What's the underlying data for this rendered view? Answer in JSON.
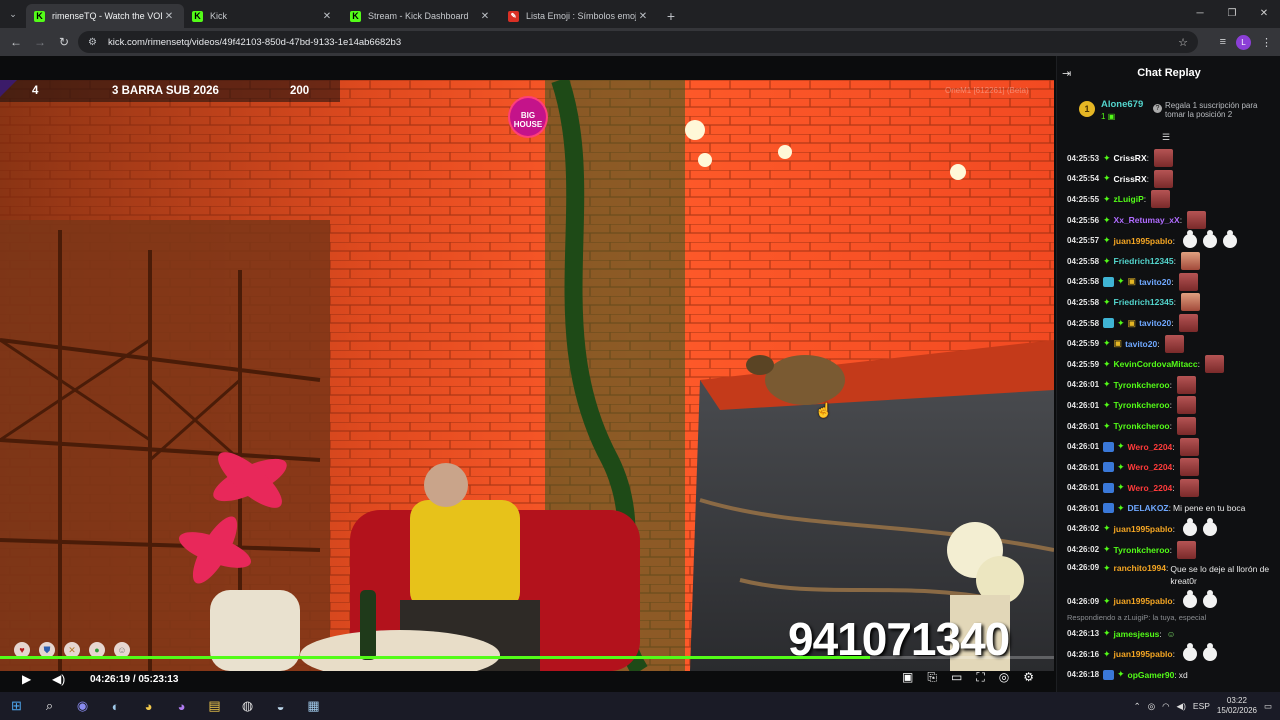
{
  "browser": {
    "tabs": [
      {
        "title": "rimenseTQ - Watch the VOD o",
        "favicon": "K",
        "active": true
      },
      {
        "title": "Kick",
        "favicon": "K",
        "active": false
      },
      {
        "title": "Stream - Kick Dashboard",
        "favicon": "K",
        "active": false
      },
      {
        "title": "Lista Emoji : Símbolos emoji na",
        "favicon": "emoji",
        "active": false
      }
    ],
    "url": "kick.com/rimensetq/videos/49f42103-850d-47bd-9133-1e14ab6682b3",
    "profile_initial": "L"
  },
  "overlay": {
    "left_number": "4",
    "title": "3 BARRA SUB 2026",
    "right_number": "200",
    "watermark": "OneM1 [612261] (Beta)",
    "logo_text": "BIG HOUSE",
    "counter": "941071340",
    "mini_icons": [
      "heart-icon",
      "shield-icon",
      "cross-icon",
      "circle-icon",
      "person-icon"
    ]
  },
  "player": {
    "current_time": "04:26:19",
    "separator": "/",
    "duration": "05:23:13",
    "progress": 0.825
  },
  "chat": {
    "title": "Chat Replay",
    "pinned": {
      "rank": "1",
      "user": "Alone679",
      "count": "1",
      "text": "Regala 1 suscripción para tomar la posición 2"
    },
    "messages": [
      {
        "ts": "04:25:53",
        "badges": [
          "green"
        ],
        "user": "CrissRX",
        "color": "#ffffff",
        "emotes": [
          "emote"
        ]
      },
      {
        "ts": "04:25:54",
        "badges": [
          "green"
        ],
        "user": "CrissRX",
        "color": "#ffffff",
        "emotes": [
          "emote"
        ]
      },
      {
        "ts": "04:25:55",
        "badges": [
          "green"
        ],
        "user": "zLuigiP",
        "color": "#53fc18",
        "emotes": [
          "emote"
        ]
      },
      {
        "ts": "04:25:56",
        "badges": [
          "green"
        ],
        "user": "Xx_Retumay_xX",
        "color": "#b06cff",
        "emotes": [
          "emote"
        ]
      },
      {
        "ts": "04:25:57",
        "badges": [
          "green"
        ],
        "user": "juan1995pablo",
        "color": "#f5a623",
        "emotes": [
          "duck",
          "duck",
          "duck"
        ]
      },
      {
        "ts": "04:25:58",
        "badges": [
          "green"
        ],
        "user": "Friedrich12345",
        "color": "#53d4cc",
        "emotes": [
          "face"
        ]
      },
      {
        "ts": "04:25:58",
        "badges": [
          "cyan",
          "green",
          "gift"
        ],
        "user": "tavito20",
        "color": "#6fa8ff",
        "emotes": [
          "emote"
        ]
      },
      {
        "ts": "04:25:58",
        "badges": [
          "green"
        ],
        "user": "Friedrich12345",
        "color": "#53d4cc",
        "emotes": [
          "face"
        ]
      },
      {
        "ts": "04:25:58",
        "badges": [
          "cyan",
          "green",
          "gift"
        ],
        "user": "tavito20",
        "color": "#6fa8ff",
        "emotes": [
          "emote"
        ]
      },
      {
        "ts": "04:25:59",
        "badges": [
          "green",
          "gift"
        ],
        "user": "tavito20",
        "color": "#6fa8ff",
        "emotes": [
          "emote"
        ]
      },
      {
        "ts": "04:25:59",
        "badges": [
          "green"
        ],
        "user": "KevinCordovaMitacc",
        "color": "#53fc18",
        "emotes": [
          "emote"
        ]
      },
      {
        "ts": "04:26:01",
        "badges": [
          "green"
        ],
        "user": "Tyronkcheroo",
        "color": "#53fc18",
        "emotes": [
          "emote"
        ]
      },
      {
        "ts": "04:26:01",
        "badges": [
          "green"
        ],
        "user": "Tyronkcheroo",
        "color": "#53fc18",
        "emotes": [
          "emote"
        ]
      },
      {
        "ts": "04:26:01",
        "badges": [
          "green"
        ],
        "user": "Tyronkcheroo",
        "color": "#53fc18",
        "emotes": [
          "emote"
        ]
      },
      {
        "ts": "04:26:01",
        "badges": [
          "blue",
          "green"
        ],
        "user": "Wero_2204",
        "color": "#ff3b3b",
        "emotes": [
          "emote"
        ]
      },
      {
        "ts": "04:26:01",
        "badges": [
          "blue",
          "green"
        ],
        "user": "Wero_2204",
        "color": "#ff3b3b",
        "emotes": [
          "emote"
        ]
      },
      {
        "ts": "04:26:01",
        "badges": [
          "blue",
          "green"
        ],
        "user": "Wero_2204",
        "color": "#ff3b3b",
        "emotes": [
          "emote"
        ]
      },
      {
        "ts": "04:26:01",
        "badges": [
          "blue",
          "green"
        ],
        "user": "DELAKOZ",
        "color": "#6fa8ff",
        "text": "Mi pene en tu boca"
      },
      {
        "ts": "04:26:02",
        "badges": [
          "green"
        ],
        "user": "juan1995pablo",
        "color": "#f5a623",
        "emotes": [
          "duck",
          "duck"
        ]
      },
      {
        "ts": "04:26:02",
        "badges": [
          "green"
        ],
        "user": "Tyronkcheroo",
        "color": "#53fc18",
        "emotes": [
          "emote"
        ]
      },
      {
        "ts": "04:26:09",
        "badges": [
          "green"
        ],
        "user": "ranchito1994",
        "color": "#f5a623",
        "text": "Que se lo deje al llorón de kreat0r",
        "tall": true
      },
      {
        "ts": "04:26:09",
        "badges": [
          "green"
        ],
        "user": "juan1995pablo",
        "color": "#f5a623",
        "emotes": [
          "duck",
          "duck"
        ]
      },
      {
        "reply": "Respondiendo a zLuigiP: la tuya, especial"
      },
      {
        "ts": "04:26:13",
        "badges": [
          "green"
        ],
        "user": "jamesjesus",
        "color": "#53fc18",
        "emotes": [
          "smile"
        ]
      },
      {
        "ts": "04:26:16",
        "badges": [
          "green"
        ],
        "user": "juan1995pablo",
        "color": "#f5a623",
        "emotes": [
          "duck",
          "duck"
        ]
      },
      {
        "ts": "04:26:18",
        "badges": [
          "blue",
          "green"
        ],
        "user": "opGamer90",
        "color": "#53fc18",
        "text": "xd"
      }
    ]
  },
  "taskbar": {
    "language": "ESP",
    "time": "03:22",
    "date": "15/02/2026"
  }
}
